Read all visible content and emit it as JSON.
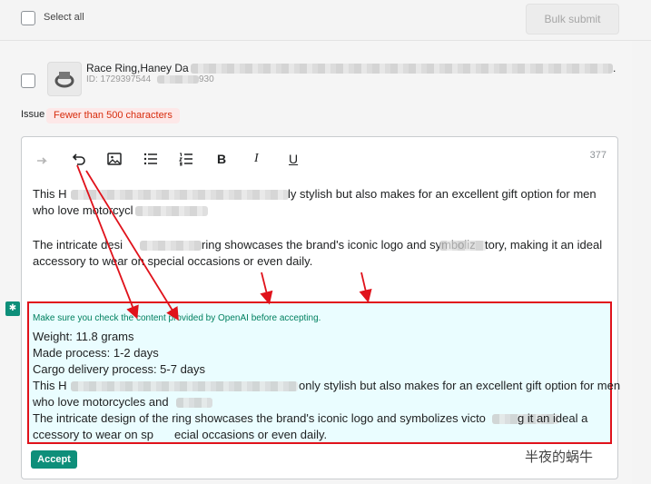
{
  "header": {
    "select_all_label": "Select all",
    "bulk_submit_label": "Bulk submit"
  },
  "product": {
    "title": "Race Ring,Haney Da",
    "id_prefix": "ID: 1729397544",
    "id_suffix": "930",
    "title_tail": "."
  },
  "issue": {
    "label": "Issue",
    "badge": "Fewer than 500 characters",
    "badge_color": "#d72c0d"
  },
  "editor": {
    "char_count": "377",
    "toolbar": [
      "redo-icon",
      "undo-icon",
      "image-icon",
      "bullet-list-icon",
      "numbered-list-icon",
      "bold-icon",
      "italic-icon",
      "underline-icon"
    ],
    "bold_label": "B",
    "italic_label": "I",
    "underline_label": "U",
    "paragraphs": {
      "p1_a": "This H",
      "p1_b": "ly stylish but also makes for an excellent gift option for men",
      "p1_line2": "who love motorcycl",
      "p2_a": "The intricate desi",
      "p2_b": "ring showcases the brand's iconic logo and symboliz",
      "p2_c": "tory, making it an ideal",
      "p2_line2": "accessory to wear on special occasions or even daily."
    }
  },
  "ai_suggestion": {
    "note": "Make sure you check the content provided by OpenAI before accepting.",
    "weight": "Weight: 11.8 grams",
    "made_process": "Made process: 1-2 days",
    "cargo": "Cargo delivery process: 5-7 days",
    "l4_a": "This H",
    "l4_b": "only stylish but also makes for an excellent gift option for men",
    "l5": "who love motorcycles and",
    "l6_a": "The intricate design of the ring showcases the brand's iconic logo and symbolizes victo",
    "l6_b": "g it an ideal a",
    "l7_a": "ccessory to wear on sp",
    "l7_b": "ecial occasions or even daily.",
    "accept_label": "Accept",
    "border_color": "#e0121b",
    "accent_color": "#0e8f7a"
  },
  "watermark": "半夜的蜗牛"
}
